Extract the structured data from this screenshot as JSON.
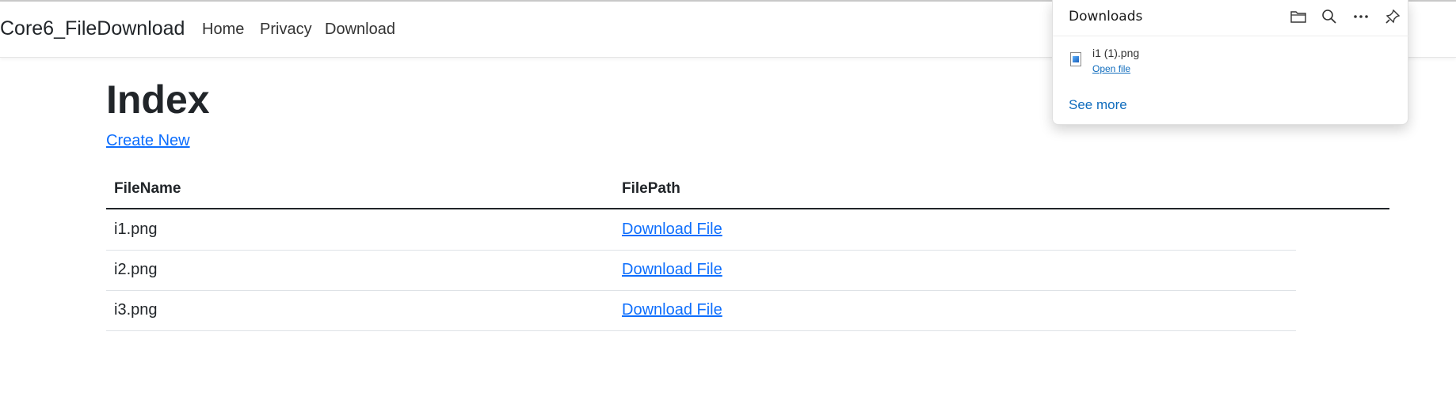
{
  "navbar": {
    "brand": "Core6_FileDownload",
    "links": [
      "Home",
      "Privacy",
      "Download"
    ]
  },
  "main": {
    "title": "Index",
    "create_link": "Create New",
    "table": {
      "headers": [
        "FileName",
        "FilePath"
      ],
      "rows": [
        {
          "file_name": "i1.png",
          "file_path": "Download File"
        },
        {
          "file_name": "i2.png",
          "file_path": "Download File"
        },
        {
          "file_name": "i3.png",
          "file_path": "Download File"
        }
      ]
    }
  },
  "downloads_flyout": {
    "title": "Downloads",
    "icons": [
      "folder-icon",
      "search-icon",
      "more-icon",
      "pin-icon"
    ],
    "item": {
      "file_name": "i1 (1).png",
      "action": "Open file"
    },
    "see_more": "See more"
  },
  "colors": {
    "link": "#0d6efd",
    "flyout_link": "#0f6cbd",
    "text": "#212529"
  }
}
